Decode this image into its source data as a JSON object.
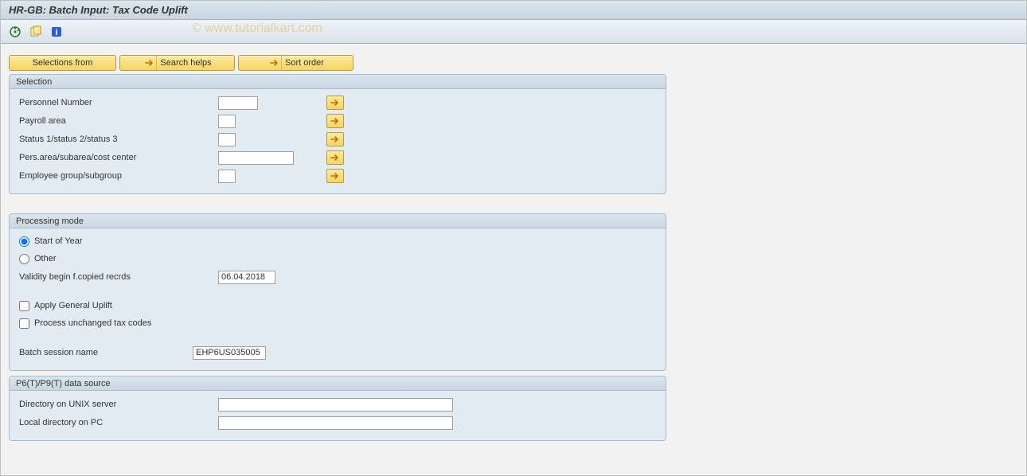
{
  "title": "HR-GB: Batch Input: Tax Code Uplift",
  "watermark": "© www.tutorialkart.com",
  "app_buttons": {
    "selections_from": "Selections from",
    "search_helps": "Search helps",
    "sort_order": "Sort order"
  },
  "selection": {
    "header": "Selection",
    "personnel_number": "Personnel Number",
    "payroll_area": "Payroll area",
    "status123": "Status 1/status 2/status 3",
    "pers_area": "Pers.area/subarea/cost center",
    "employee_group": "Employee group/subgroup"
  },
  "processing": {
    "header": "Processing mode",
    "start_of_year": "Start of Year",
    "other": "Other",
    "validity_begin": "Validity begin f.copied recrds",
    "validity_date": "06.04.2018",
    "apply_uplift": "Apply General Uplift",
    "process_unchanged": "Process unchanged tax codes",
    "batch_session": "Batch session name",
    "batch_value": "EHP6US035005"
  },
  "datasource": {
    "header": "P6(T)/P9(T) data source",
    "unix_dir": "Directory on UNIX server",
    "local_dir": "Local directory on PC"
  },
  "icons": {
    "execute": "execute-icon",
    "variant": "variant-icon",
    "info": "info-icon",
    "arrow": "arrow-right-icon"
  }
}
